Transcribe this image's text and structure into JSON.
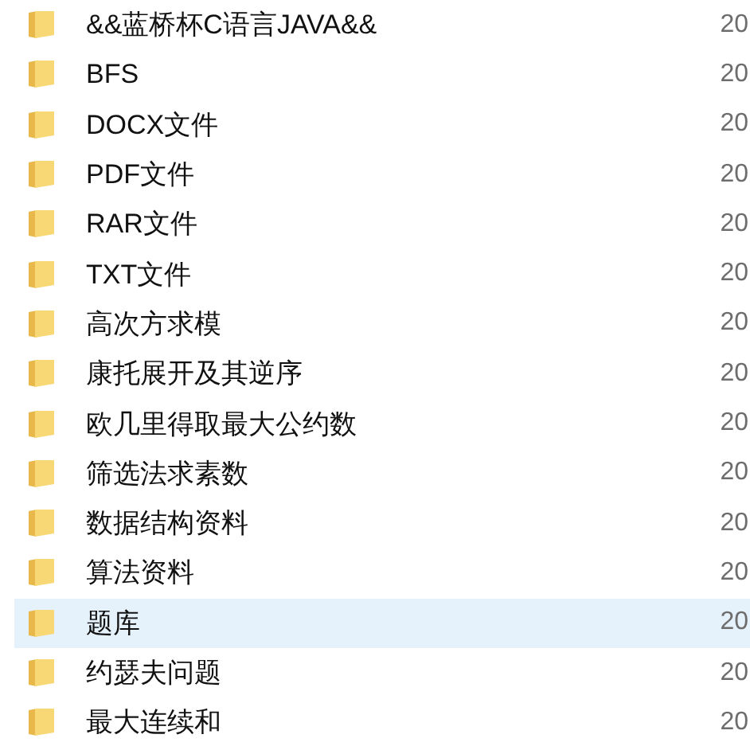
{
  "files": [
    {
      "name": "&&蓝桥杯C语言JAVA&&",
      "date": "20",
      "selected": false
    },
    {
      "name": "BFS",
      "date": "20",
      "selected": false
    },
    {
      "name": "DOCX文件",
      "date": "20",
      "selected": false
    },
    {
      "name": "PDF文件",
      "date": "20",
      "selected": false
    },
    {
      "name": "RAR文件",
      "date": "20",
      "selected": false
    },
    {
      "name": "TXT文件",
      "date": "20",
      "selected": false
    },
    {
      "name": "高次方求模",
      "date": "20",
      "selected": false
    },
    {
      "name": "康托展开及其逆序",
      "date": "20",
      "selected": false
    },
    {
      "name": "欧几里得取最大公约数",
      "date": "20",
      "selected": false
    },
    {
      "name": "筛选法求素数",
      "date": "20",
      "selected": false
    },
    {
      "name": "数据结构资料",
      "date": "20",
      "selected": false
    },
    {
      "name": "算法资料",
      "date": "20",
      "selected": false
    },
    {
      "name": "题库",
      "date": "20",
      "selected": true
    },
    {
      "name": "约瑟夫问题",
      "date": "20",
      "selected": false
    },
    {
      "name": "最大连续和",
      "date": "20",
      "selected": false
    }
  ]
}
